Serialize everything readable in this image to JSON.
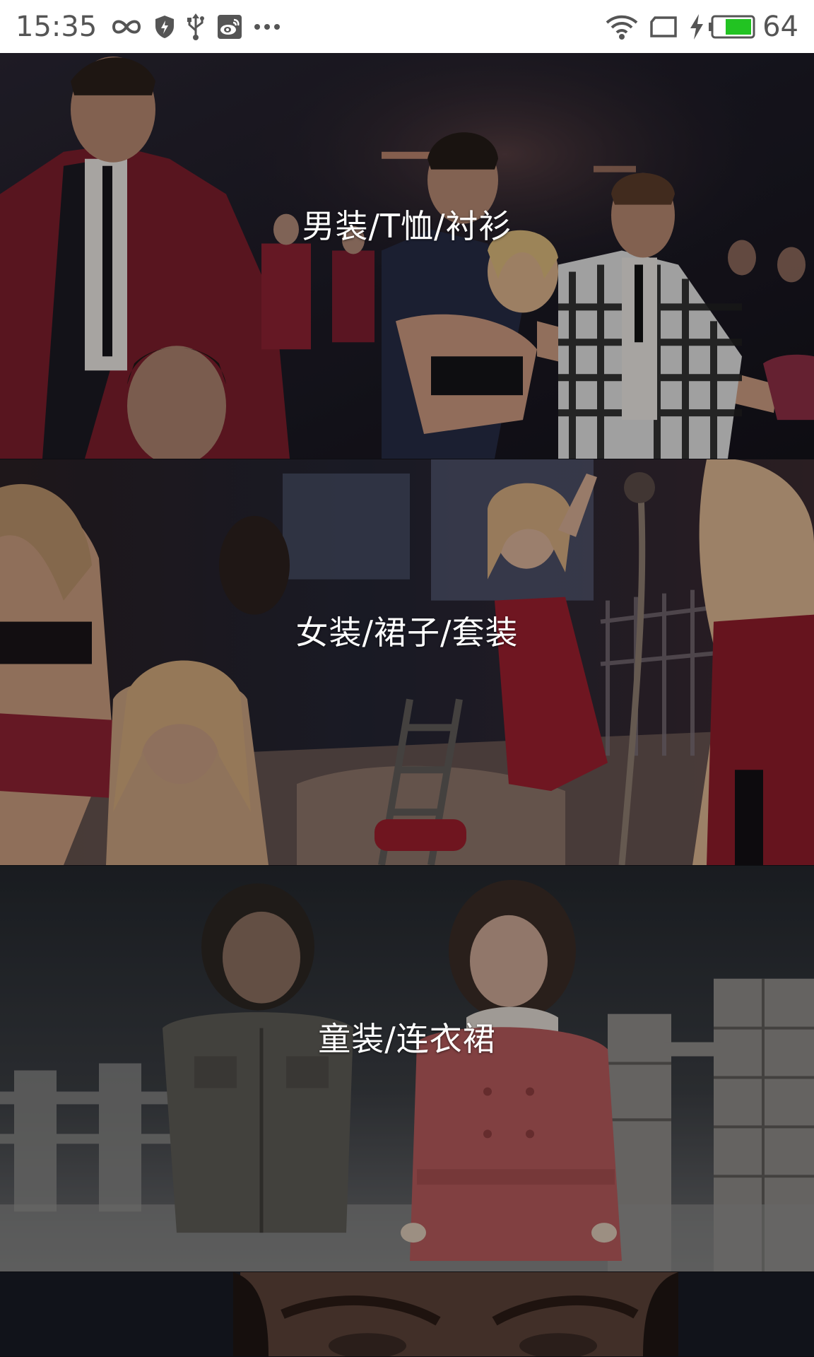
{
  "status_bar": {
    "time": "15:35",
    "battery_level": "64",
    "icons": [
      "infinity-icon",
      "shield-icon",
      "usb-icon",
      "weibo-icon",
      "more-dots-icon",
      "wifi-icon",
      "screen-cast-icon",
      "charging-bolt-icon",
      "battery-icon"
    ],
    "battery_fill_color": "#22c322"
  },
  "categories": [
    {
      "label": "男装/T恤/衬衫",
      "image": "men-fashion-photo"
    },
    {
      "label": "女装/裙子/套装",
      "image": "women-fashion-photo"
    },
    {
      "label": "童装/连衣裙",
      "image": "kids-fashion-photo"
    },
    {
      "label": "",
      "image": "face-closeup-photo"
    }
  ]
}
